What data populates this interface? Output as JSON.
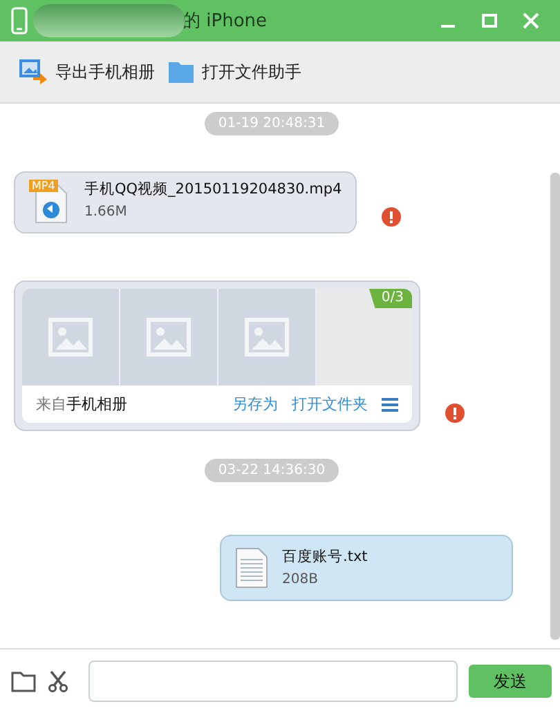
{
  "window": {
    "title": "的 iPhone"
  },
  "toolbar": [
    {
      "kind": "export",
      "label": "导出手机相册"
    },
    {
      "kind": "folder",
      "label": "打开文件助手"
    }
  ],
  "messages": [
    {
      "kind": "time",
      "text": "01-19 20:48:31"
    },
    {
      "kind": "received_file",
      "file_badge": "MP4",
      "name": "手机QQ视频_20150119204830.mp4",
      "size": "1.66M",
      "failed": true
    },
    {
      "kind": "received_album",
      "thumbnails": [
        {
          "kind": "placeholder"
        },
        {
          "kind": "placeholder"
        },
        {
          "kind": "placeholder"
        }
      ],
      "counter": "0/3",
      "source_prefix": "来自",
      "source_name": "手机相册",
      "actions": [
        "另存为",
        "打开文件夹"
      ],
      "failed": true
    },
    {
      "kind": "time",
      "text": "03-22 14:36:30"
    },
    {
      "kind": "sent_file",
      "name": "百度账号.txt",
      "size": "208B",
      "failed": false
    }
  ],
  "composer": {
    "send_label": "发送"
  }
}
